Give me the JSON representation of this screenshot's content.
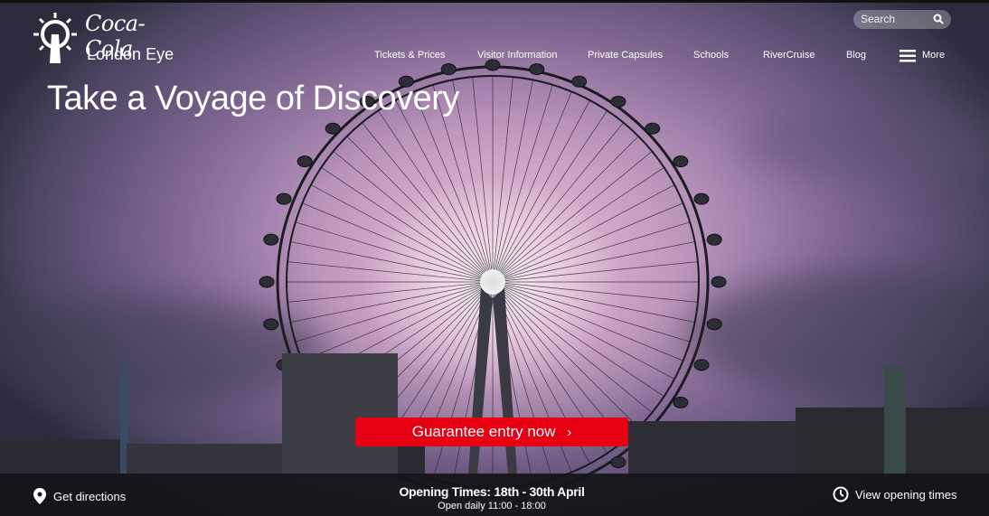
{
  "brand": {
    "logo_text": "Coca-Cola",
    "name": "London Eye"
  },
  "search": {
    "placeholder": "Search"
  },
  "nav": {
    "items": [
      "Tickets & Prices",
      "Visitor Information",
      "Private Capsules",
      "Schools",
      "RiverCruise",
      "Blog"
    ],
    "more_label": "More"
  },
  "hero": {
    "headline": "Take a Voyage of Discovery",
    "cta_label": "Guarantee entry now",
    "cta_icon": "chevron-right-icon",
    "cta_color": "#e60012"
  },
  "footer_bar": {
    "directions_label": "Get directions",
    "opening_title": "Opening Times: 18th - 30th April",
    "opening_hours": "Open daily 11:00 - 18:00",
    "view_times_label": "View opening times"
  },
  "icons": [
    "sun-logo-icon",
    "search-icon",
    "menu-icon",
    "location-pin-icon",
    "clock-icon"
  ]
}
